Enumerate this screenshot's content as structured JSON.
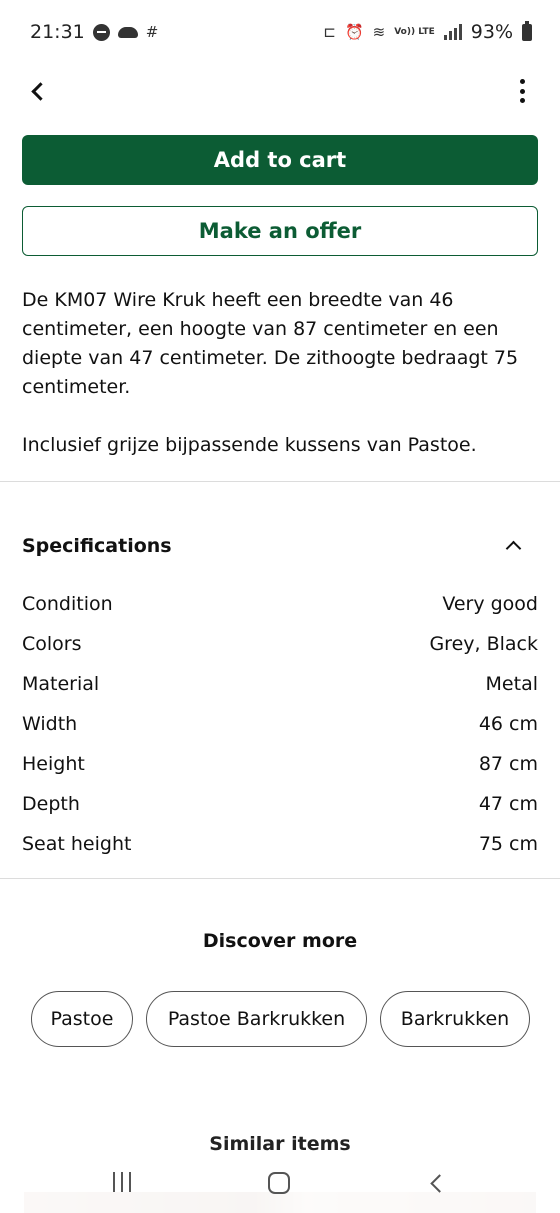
{
  "status_bar": {
    "time": "21:31",
    "battery": "93%",
    "network_label": "Vo)) LTE",
    "left_icons": [
      "do-not-disturb-icon",
      "cloud-icon",
      "hashtag-activity-icon"
    ],
    "right_icons": [
      "sleep-mode-icon",
      "alarm-icon",
      "wifi-icon",
      "volte-lte-icon",
      "signal-icon",
      "battery-icon"
    ]
  },
  "top_bar": {
    "back_icon": "chevron-left-icon",
    "more_icon": "more-vertical-icon"
  },
  "actions": {
    "add_to_cart": "Add to cart",
    "make_offer": "Make an offer",
    "primary_color": "#0c5c34"
  },
  "description": {
    "main": "De KM07 Wire Kruk heeft een breedte van 46 centimeter, een hoogte van 87 centimeter en een diepte van 47 centimeter. De zithoogte bedraagt 75 centimeter.",
    "extra": "Inclusief grijze bijpassende kussens van Pastoe."
  },
  "specifications": {
    "title": "Specifications",
    "rows": [
      {
        "label": "Condition",
        "value": "Very good"
      },
      {
        "label": "Colors",
        "value": "Grey, Black"
      },
      {
        "label": "Material",
        "value": "Metal"
      },
      {
        "label": "Width",
        "value": "46 cm"
      },
      {
        "label": "Height",
        "value": "87 cm"
      },
      {
        "label": "Depth",
        "value": "47 cm"
      },
      {
        "label": "Seat height",
        "value": "75 cm"
      }
    ]
  },
  "discover": {
    "title": "Discover more",
    "chips": [
      "Pastoe",
      "Pastoe Barkrukken",
      "Barkrukken"
    ]
  },
  "similar": {
    "title": "Similar items"
  }
}
